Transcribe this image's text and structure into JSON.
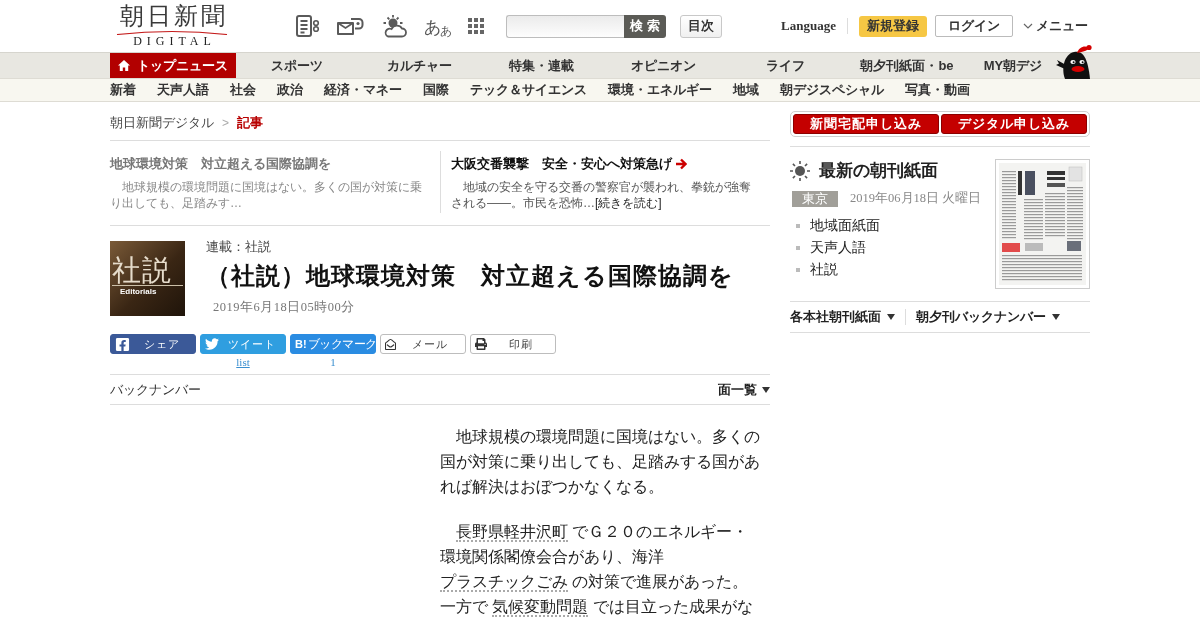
{
  "header": {
    "logo": {
      "title": "朝日新聞",
      "subtitle": "DIGITAL"
    },
    "font_size_button": {
      "large": "あ",
      "small": "あ"
    },
    "search": {
      "button": "検 索"
    },
    "contents_button": "目次",
    "language_link": "Language",
    "register_button": "新規登録",
    "login_button": "ログイン",
    "menu_button": "メニュー"
  },
  "main_nav": [
    {
      "label": "トップニュース",
      "kind": "home",
      "selected": true
    },
    {
      "label": "スポーツ",
      "kind": "section",
      "selected": false
    },
    {
      "label": "カルチャー",
      "kind": "section",
      "selected": false
    },
    {
      "label": "特集・連載",
      "kind": "section",
      "selected": false
    },
    {
      "label": "オピニオン",
      "kind": "section",
      "selected": false
    },
    {
      "label": "ライフ",
      "kind": "section",
      "selected": false
    },
    {
      "label": "朝夕刊紙面・be",
      "kind": "section",
      "selected": false
    },
    {
      "label": "MY朝デジ",
      "kind": "section",
      "selected": false
    }
  ],
  "sub_nav": [
    "新着",
    "天声人語",
    "社会",
    "政治",
    "経済・マネー",
    "国際",
    "テック＆サイエンス",
    "環境・エネルギー",
    "地域",
    "朝デジスペシャル",
    "写真・動画"
  ],
  "breadcrumb": {
    "separator": ">",
    "items": [
      {
        "label": "朝日新聞デジタル",
        "current": false
      },
      {
        "label": "記事",
        "current": true
      }
    ]
  },
  "teasers": [
    {
      "title": "地球環境対策　対立超える国際協調を",
      "excerpt": "　地球規模の環境問題に国境はない。多くの国が対策に乗り出しても、足踏みす…",
      "current": true
    },
    {
      "title": "大阪交番襲撃　安全・安心へ対策急げ",
      "excerpt": "　地域の安全を守る交番の警察官が襲われ、拳銃が強奪される――。市民を恐怖…",
      "read_more": "[続きを読む]",
      "current": false
    }
  ],
  "article": {
    "thumbnail": {
      "title": "社説",
      "subtitle": "Editorials"
    },
    "series": "連載：社説",
    "title": "（社説）地球環境対策　対立超える国際協調を",
    "date": "2019年6月18日05時00分",
    "share": [
      {
        "kind": "facebook",
        "label": "シェア"
      },
      {
        "kind": "twitter",
        "label": "ツイート",
        "count": "list"
      },
      {
        "kind": "hatena",
        "logo": "B!",
        "label": "ブックマーク",
        "count": "1"
      },
      {
        "kind": "mail",
        "label": "メール"
      },
      {
        "kind": "print",
        "label": "印刷"
      }
    ],
    "back_number": "バックナンバー",
    "page_list": "面一覧",
    "body": [
      {
        "segments": [
          {
            "kind": "text",
            "text": "地球規模の環境問題に国境はない。多くの国が対策に乗り出しても、足踏みする国があれば解決はおぼつかなくなる。"
          }
        ]
      },
      {
        "segments": [
          {
            "kind": "link",
            "text": "長野県軽井沢町"
          },
          {
            "kind": "text",
            "text": " でＧ２０のエネルギー・環境関係閣僚会合があり、海洋 "
          },
          {
            "kind": "link",
            "text": "プラスチックごみ"
          },
          {
            "kind": "text",
            "text": " の対策で進展があった。一方で "
          },
          {
            "kind": "link",
            "text": "気候変動問題"
          },
          {
            "kind": "text",
            "text": " では目立った成果がな"
          }
        ]
      }
    ]
  },
  "sidebar": {
    "subscribe_buttons": [
      "新聞宅配申し込み",
      "デジタル申し込み"
    ],
    "paper": {
      "title": "最新の朝刊紙面",
      "region": "東京",
      "date": "2019年06月18日 火曜日",
      "links": [
        "地域面紙面",
        "天声人語",
        "社説"
      ]
    },
    "dropdowns": [
      "各本社朝刊紙面",
      "朝夕刊バックナンバー"
    ]
  }
}
